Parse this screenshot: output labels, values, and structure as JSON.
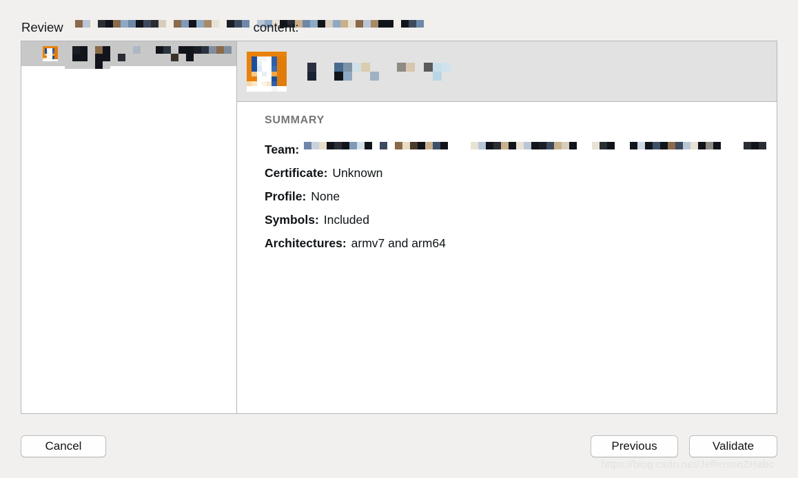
{
  "dialog": {
    "title_prefix": "Review",
    "title_suffix": "content:",
    "title_redacted": true
  },
  "colors": {
    "window_background": "#f1f0ef",
    "panel_background": "#ffffff",
    "panel_border": "#b6b6b6",
    "selected_row": "#c8c8c8",
    "header_band": "#e2e2e2",
    "summary_heading": "#767676",
    "body_text": "#0f1316",
    "button_face": "#ffffff",
    "button_border": "#bdbdbd",
    "icon_orange": "#e8820c",
    "icon_blue": "#1b4f9c",
    "watermark": "#e2e2e2"
  },
  "left_list": {
    "items": [
      {
        "icon": "app-icon",
        "label_redacted": true,
        "selected": true
      }
    ]
  },
  "app_header": {
    "icon": "app-icon",
    "name_redacted": true
  },
  "summary": {
    "heading": "SUMMARY",
    "rows": [
      {
        "label": "Team:",
        "value": "",
        "redacted": true
      },
      {
        "label": "Certificate:",
        "value": "Unknown",
        "redacted": false
      },
      {
        "label": "Profile:",
        "value": "None",
        "redacted": false
      },
      {
        "label": "Symbols:",
        "value": "Included",
        "redacted": false
      },
      {
        "label": "Architectures:",
        "value": "armv7 and arm64",
        "redacted": false
      }
    ]
  },
  "footer": {
    "cancel_label": "Cancel",
    "previous_label": "Previous",
    "validate_label": "Validate"
  },
  "watermark": {
    "text": "https://blog.csdn.net/JeffersonZHabc"
  },
  "redactions": {
    "title": {
      "block": 11,
      "rows": 2,
      "palette": [
        "#f2eee8",
        "#8fa8c4",
        "#6d88a8",
        "#2a2d33",
        "#11141a",
        "#8a6a4a",
        "#c9b08c",
        "#e8e2d4",
        "#b9c6d6",
        "#3d4a5e",
        "#d8cdbc",
        "#7f9ab8",
        "#1b1e24",
        "#a88a68"
      ],
      "cells": [
        "#f2eee8",
        "#8a6a4a",
        "#b9c6d6",
        "#f2eee8",
        "#2a2d33",
        "#11141a",
        "#8a6a4a",
        "#8fa8c4",
        "#6d88a8",
        "#11141a",
        "#3d4a5e",
        "#2a2d33",
        "#d8cdbc",
        "#f2eee8",
        "#8a6a4a",
        "#7f9ab8",
        "#11141a",
        "#8fa8c4",
        "#a88a68",
        "#e8e2d4",
        "#f2eee8",
        "#1b1e24",
        "#3d4a5e",
        "#6d88a8",
        "#f2eee8",
        "#b9c6d6",
        "#8fa8c4",
        "#e8e2d4",
        "#11141a",
        "#2a2d33",
        "#c9b08c",
        "#6d88a8",
        "#8fa8c4",
        "#11141a",
        "#d8cdbc",
        "#8fa8c4",
        "#c9b08c",
        "#e8e2d4",
        "#8a6a4a",
        "#b9c6d6",
        "#a88a68",
        "#11141a",
        "#11141a",
        "#f2eee8",
        "#11141a",
        "#3d4a5e",
        "#6d88a8",
        "#f2eee8"
      ]
    },
    "list_label": {
      "block": 11,
      "rows": 2,
      "cells": [
        "#c8c8c8",
        "#1b1e24",
        "#11141a",
        "#c8c8c8",
        "#8a6a4a",
        "#11141a",
        "#c8c8c8",
        "#c8c8c8",
        "#c8c8c8",
        "#aeb8c4",
        "#c8c8c8",
        "#c8c8c8",
        "#11141a",
        "#2a3340",
        "#c8c8c8",
        "#11141a",
        "#11141a",
        "#1b1e24",
        "#2a3340",
        "#7f8d9e",
        "#8a6a4a",
        "#7f8d9e",
        "#c8c8c8",
        "#11141a",
        "#11141a",
        "#c8c8c8",
        "#11141a",
        "#11141a",
        "#c8c8c8",
        "#2a2d33",
        "#c8c8c8",
        "#c8c8c8",
        "#c8c8c8",
        "#c8c8c8",
        "#c8c8c8",
        "#c8c8c8",
        "#3a3228",
        "#c8c8c8",
        "#11141a",
        "#c8c8c8",
        "#c8c8c8",
        "#c8c8c8",
        "#c8c8c8",
        "#c8c8c8",
        "#c8c8c8",
        "#c8c8c8",
        "#c8c8c8",
        "#c8c8c8",
        "#11141a",
        "#c8c8c8"
      ]
    },
    "app_name": {
      "block": 13,
      "rows": 2,
      "cells": [
        "#2a3040",
        "#e2e2e2",
        "#e2e2e2",
        "#4a6b90",
        "#7e94a6",
        "#cfe0e8",
        "#d9cdae",
        "#e2e2e2",
        "#e2e2e2",
        "#e2e2e2",
        "#8e8a84",
        "#d8c6ae",
        "#e2e2e2",
        "#5a5a58",
        "#c9e0ea",
        "#cfe3ee",
        "#1b2433",
        "#e2e2e2",
        "#e2e2e2",
        "#11141a",
        "#8fa8c4",
        "#e2e2e2",
        "#e2e2e2",
        "#9fb2c2",
        "#e2e2e2",
        "#e2e2e2",
        "#e2e2e2",
        "#e2e2e2",
        "#e2e2e2",
        "#e2e2e2",
        "#b9d6e4",
        "#e2e2e2"
      ]
    },
    "team_value": {
      "block": 11,
      "rows": 2,
      "cells": [
        "#6f87a8",
        "#c9d2dc",
        "#e8ddc9",
        "#11141a",
        "#2a2d33",
        "#11141a",
        "#7f9ab8",
        "#d3e0ea",
        "#11141a",
        "#ffffff",
        "#3d4a5e",
        "#ffffff",
        "#8a6a4a",
        "#e8dcc2",
        "#4a3a2c",
        "#11141a",
        "#c9b08c",
        "#3d5068",
        "#11141a",
        "#ffffff",
        "#ffffff",
        "#ffffff",
        "#cfd9e4",
        "#11141a",
        "#1b1e24",
        "#11141a",
        "#c9b08c",
        "#e8e2d4",
        "#11141a",
        "#3d5068",
        "#8a6a4a",
        "#c9b08c",
        "#11141a",
        "#2a2d33",
        "#e8dcc2",
        "#11141a",
        "#ffffff",
        "#ffffff",
        "#ffffff",
        "#ffffff"
      ],
      "cells2": [
        "#e8e2d4",
        "#b9c6d6",
        "#11141a",
        "#2a2d33",
        "#c9b08c",
        "#11141a",
        "#e8e2d4",
        "#b9c6d6",
        "#11141a",
        "#1b1e24",
        "#3d4a5e",
        "#c9b08c",
        "#d8cdbc",
        "#11141a",
        "#ffffff",
        "#ffffff",
        "#e8e2d4",
        "#2a2d33",
        "#11141a",
        "#ffffff",
        "#ffffff",
        "#11141a",
        "#cfd9e4",
        "#11141a",
        "#3d5068",
        "#11141a",
        "#8a6a4a",
        "#3d4a5e",
        "#b9c6d6",
        "#e8e2d4",
        "#11141a",
        "#8e8a84",
        "#11141a",
        "#ffffff",
        "#ffffff",
        "#ffffff",
        "#2a2d33",
        "#11141a",
        "#2a2d33",
        "#ffffff"
      ]
    }
  },
  "app_icon": {
    "grid": [
      "#e8820c",
      "#e8820c",
      "#e8820c",
      "#e8820c",
      "#e8820c",
      "#e8820c",
      "#e8820c",
      "#e8820c",
      "#e8820c",
      "#1b4f9c",
      "#f2f5fa",
      "#f2f5fa",
      "#ffffff",
      "#2f5ea8",
      "#e07c0a",
      "#e07c0a",
      "#e8820c",
      "#1b4f9c",
      "#e8eef8",
      "#ffffff",
      "#ffffff",
      "#2f5ea8",
      "#e07c0a",
      "#e07c0a",
      "#e8820c",
      "#1b4f9c",
      "#dde8f5",
      "#ffffff",
      "#ffffff",
      "#3a6cb4",
      "#e07c0a",
      "#e07c0a",
      "#e8820c",
      "#f7c98a",
      "#ffffff",
      "#e8eef8",
      "#ffffff",
      "#f0a445",
      "#e07c0a",
      "#e07c0a",
      "#e8820c",
      "#e8820c",
      "#ffffff",
      "#ffffff",
      "#ffffff",
      "#1b4f9c",
      "#e07c0a",
      "#e07c0a",
      "#f7d7a8",
      "#fbe6c4",
      "#ffffff",
      "#fdf4e4",
      "#f7e8cc",
      "#2f5ea8",
      "#e07c0a",
      "#e07c0a",
      "#ffffff",
      "#ffffff",
      "#ffffff",
      "#ffffff",
      "#ffffff",
      "#f2f5fa",
      "#ffffff",
      "#ffffff"
    ]
  }
}
